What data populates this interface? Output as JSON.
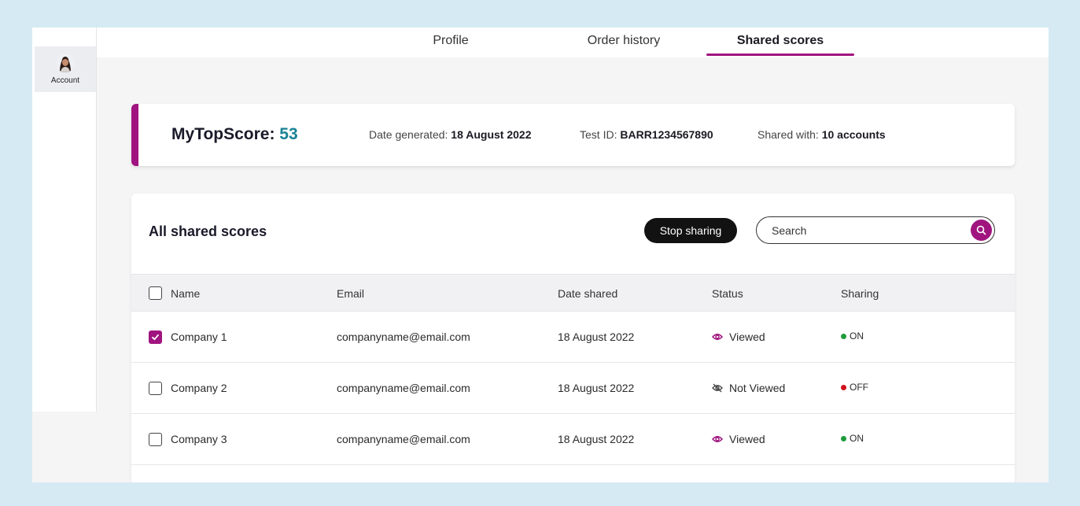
{
  "sidebar": {
    "account_label": "Account"
  },
  "tabs": [
    {
      "label": "Profile"
    },
    {
      "label": "Order history"
    },
    {
      "label": "Shared scores"
    }
  ],
  "score": {
    "label": "MyTopScore: ",
    "value": "53",
    "date_label": "Date generated: ",
    "date_value": "18 August 2022",
    "test_label": "Test ID: ",
    "test_value": "BARR1234567890",
    "shared_label": "Shared with: ",
    "shared_value": "10 accounts"
  },
  "card": {
    "title": "All shared scores",
    "stop_sharing": "Stop sharing",
    "search_placeholder": "Search"
  },
  "table": {
    "headers": [
      "Name",
      "Email",
      "Date shared",
      "Status",
      "Sharing"
    ],
    "rows": [
      {
        "name": "Company 1",
        "email": "companyname@email.com",
        "date": "18 August 2022",
        "status": "Viewed",
        "sharing": "ON",
        "checked": true
      },
      {
        "name": "Company 2",
        "email": "companyname@email.com",
        "date": "18 August 2022",
        "status": "Not Viewed",
        "sharing": "OFF",
        "checked": false
      },
      {
        "name": "Company 3",
        "email": "companyname@email.com",
        "date": "18 August 2022",
        "status": "Viewed",
        "sharing": "ON",
        "checked": false
      }
    ]
  },
  "colors": {
    "accent": "#a0147f",
    "score_value": "#1a8296",
    "on": "#1e9b3c",
    "off": "#d0121b"
  },
  "icons": {
    "viewed": "eye-icon",
    "not_viewed": "eye-off-icon",
    "search": "search-icon",
    "check": "check-icon"
  }
}
